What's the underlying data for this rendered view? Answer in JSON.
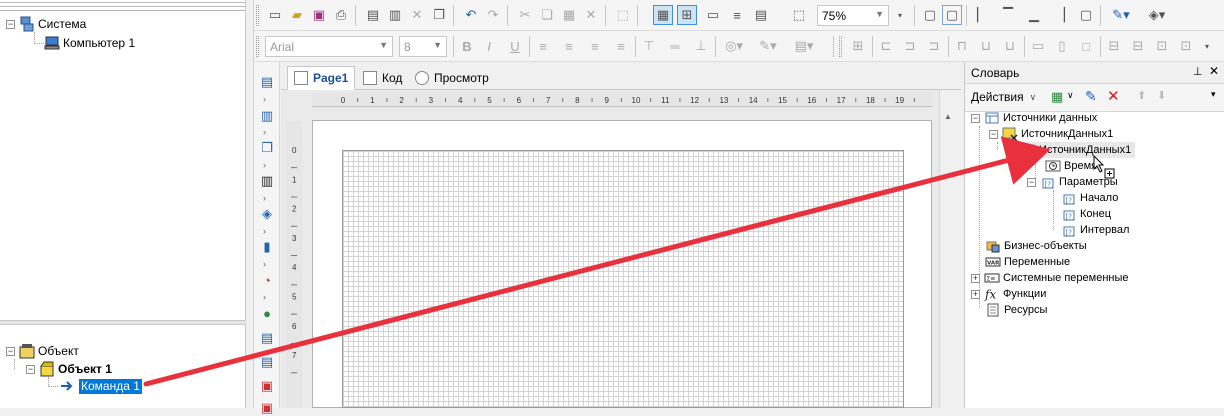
{
  "system_tree": {
    "root_label": "Система",
    "child_label": "Компьютер 1"
  },
  "object_tree": {
    "root_label": "Объект",
    "child_label": "Объект 1",
    "leaf_label": "Команда 1"
  },
  "toolbar": {
    "zoom_value": "75%",
    "font_name": "Arial",
    "font_size": "8",
    "bold_label": "B",
    "italic_label": "I",
    "underline_label": "U"
  },
  "editor": {
    "tabs": [
      {
        "label": "Page1"
      },
      {
        "label": "Код"
      },
      {
        "label": "Просмотр"
      }
    ],
    "ruler_marks": [
      "0",
      "1",
      "2",
      "3",
      "4",
      "5",
      "6",
      "7",
      "8",
      "9",
      "10",
      "11",
      "12",
      "13",
      "14",
      "15",
      "16",
      "17",
      "18",
      "19"
    ],
    "vruler_marks": [
      "0",
      "1",
      "2",
      "3",
      "4",
      "5",
      "6",
      "7"
    ]
  },
  "dictionary": {
    "title": "Словарь",
    "pin_icon": "pin-icon",
    "actions_label": "Действия",
    "tree": {
      "data_sources": "Источники данных",
      "source_group": "ИсточникДанных1",
      "source": "ИсточникДанных1",
      "time": "Время",
      "params": "Параметры",
      "start": "Начало",
      "end": "Конец",
      "interval": "Интервал",
      "business_objects": "Бизнес-объекты",
      "variables": "Переменные",
      "system_variables": "Системные переменные",
      "functions": "Функции",
      "resources": "Ресурсы"
    }
  },
  "colors": {
    "accent": "#0078d7",
    "selection": "#0078d7",
    "arrow": "#e8313c",
    "tab_active_text": "#1c4f9c"
  }
}
